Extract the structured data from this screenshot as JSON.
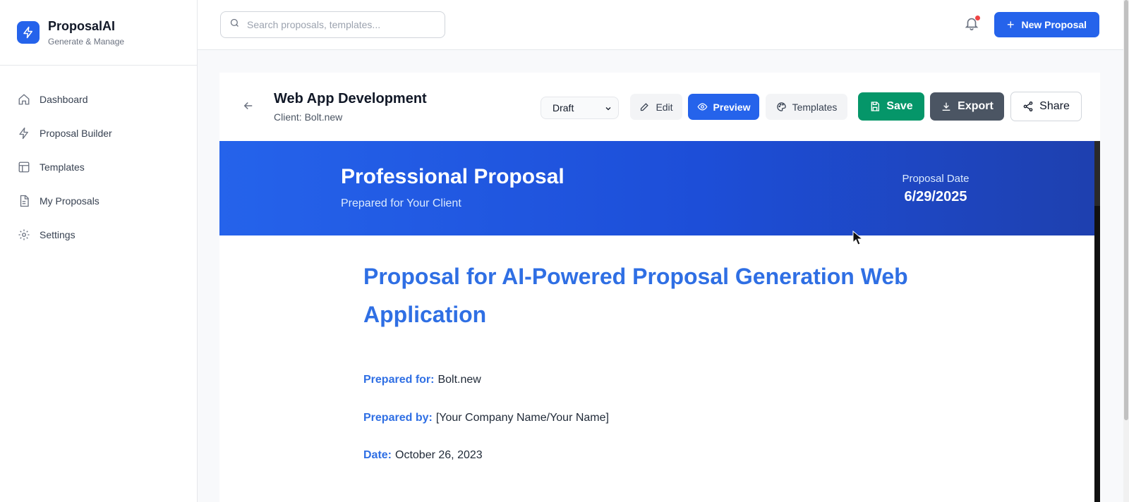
{
  "brand": {
    "name": "ProposalAI",
    "tagline": "Generate & Manage"
  },
  "nav": [
    {
      "label": "Dashboard",
      "icon": "home-icon"
    },
    {
      "label": "Proposal Builder",
      "icon": "bolt-icon"
    },
    {
      "label": "Templates",
      "icon": "layout-icon"
    },
    {
      "label": "My Proposals",
      "icon": "document-icon"
    },
    {
      "label": "Settings",
      "icon": "gear-icon"
    }
  ],
  "header": {
    "search_placeholder": "Search proposals, templates...",
    "new_button": "New Proposal"
  },
  "editor": {
    "title": "Web App Development",
    "client": "Client: Bolt.new",
    "status": "Draft",
    "buttons": {
      "edit": "Edit",
      "preview": "Preview",
      "templates": "Templates",
      "save": "Save",
      "export": "Export",
      "share": "Share"
    }
  },
  "preview": {
    "banner_title": "Professional Proposal",
    "banner_subtitle": "Prepared for Your Client",
    "date_label": "Proposal Date",
    "date_value": "6/29/2025",
    "heading": "Proposal for AI-Powered Proposal Generation Web Application",
    "meta": [
      {
        "label": "Prepared for:",
        "value": "Bolt.new"
      },
      {
        "label": "Prepared by:",
        "value": "[Your Company Name/Your Name]"
      },
      {
        "label": "Date:",
        "value": "October 26, 2023"
      }
    ]
  },
  "colors": {
    "primary": "#2563eb",
    "save": "#059669",
    "export": "#4b5563",
    "notification_dot": "#ef4444",
    "heading": "#2f6fe4"
  }
}
